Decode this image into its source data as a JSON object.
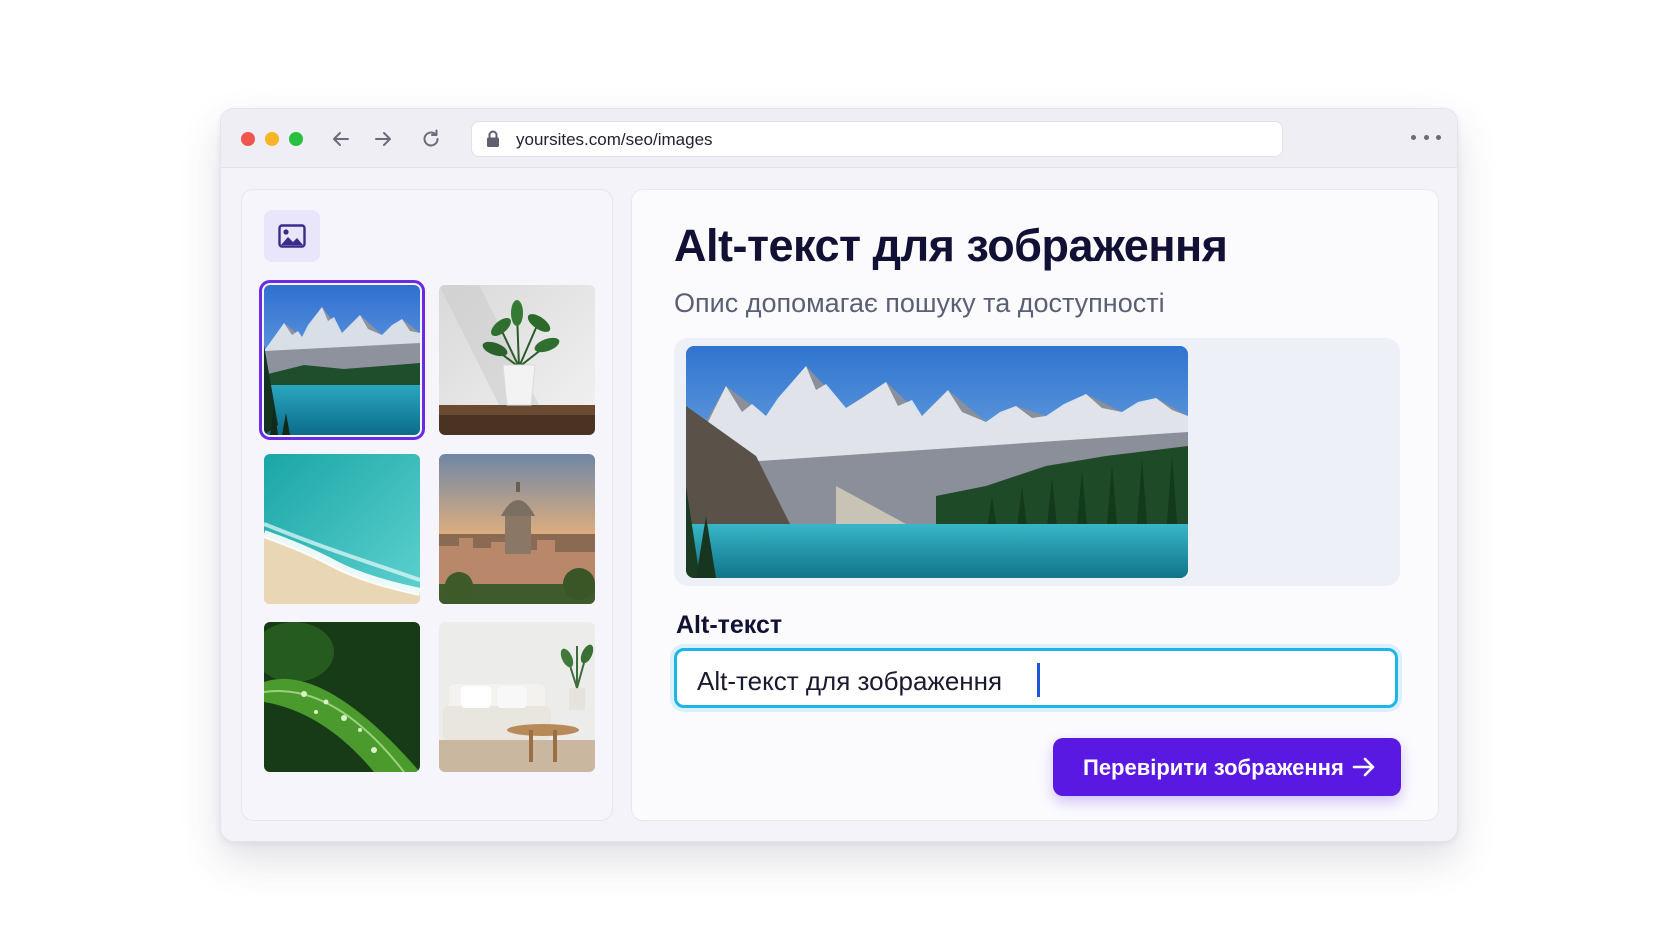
{
  "browser": {
    "url": "yoursites.com/seo/images",
    "icons": [
      "back-arrow-icon",
      "forward-arrow-icon",
      "reload-icon",
      "lock-icon",
      "more-dots-icon"
    ]
  },
  "sidebar": {
    "icon": "image-gallery-icon",
    "thumbnails": [
      {
        "subject": "mountain-lake",
        "selected": true
      },
      {
        "subject": "potted-plant",
        "selected": false
      },
      {
        "subject": "ocean-beach",
        "selected": false
      },
      {
        "subject": "city-dome",
        "selected": false
      },
      {
        "subject": "leaf-water-drops",
        "selected": false
      },
      {
        "subject": "living-room-sofa",
        "selected": false
      }
    ]
  },
  "main": {
    "title": "Alt-текст для зображення",
    "subtitle": "Опис допомагає пошуку та доступності",
    "field_label": "Alt-текст",
    "input_value": "Alt-текст для зображення",
    "button_label": "Перевірити зображення",
    "button_icon": "arrow-right-icon"
  },
  "colors": {
    "accent": "#5a19e3",
    "selection": "#6a2ae6",
    "input_focus": "#1fb4e8",
    "title": "#111136"
  }
}
